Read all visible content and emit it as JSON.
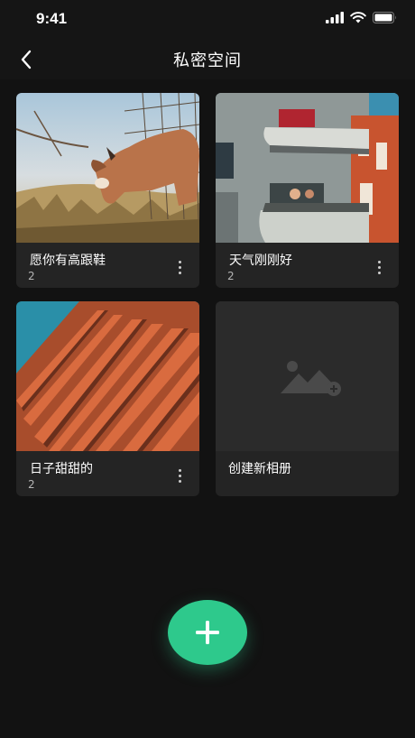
{
  "status_bar": {
    "time": "9:41"
  },
  "header": {
    "title": "私密空间"
  },
  "albums": [
    {
      "name": "愿你有高跟鞋",
      "count": "2"
    },
    {
      "name": "天气刚刚好",
      "count": "2"
    },
    {
      "name": "日子甜甜的",
      "count": "2"
    }
  ],
  "create_album": {
    "label": "创建新相册"
  },
  "icons": {
    "back": "chevron-left-icon",
    "more": "more-vertical-icon",
    "add_image": "image-add-icon",
    "fab": "plus-icon"
  },
  "colors": {
    "background": "#151515",
    "card": "#242424",
    "accent": "#2ec98c"
  }
}
